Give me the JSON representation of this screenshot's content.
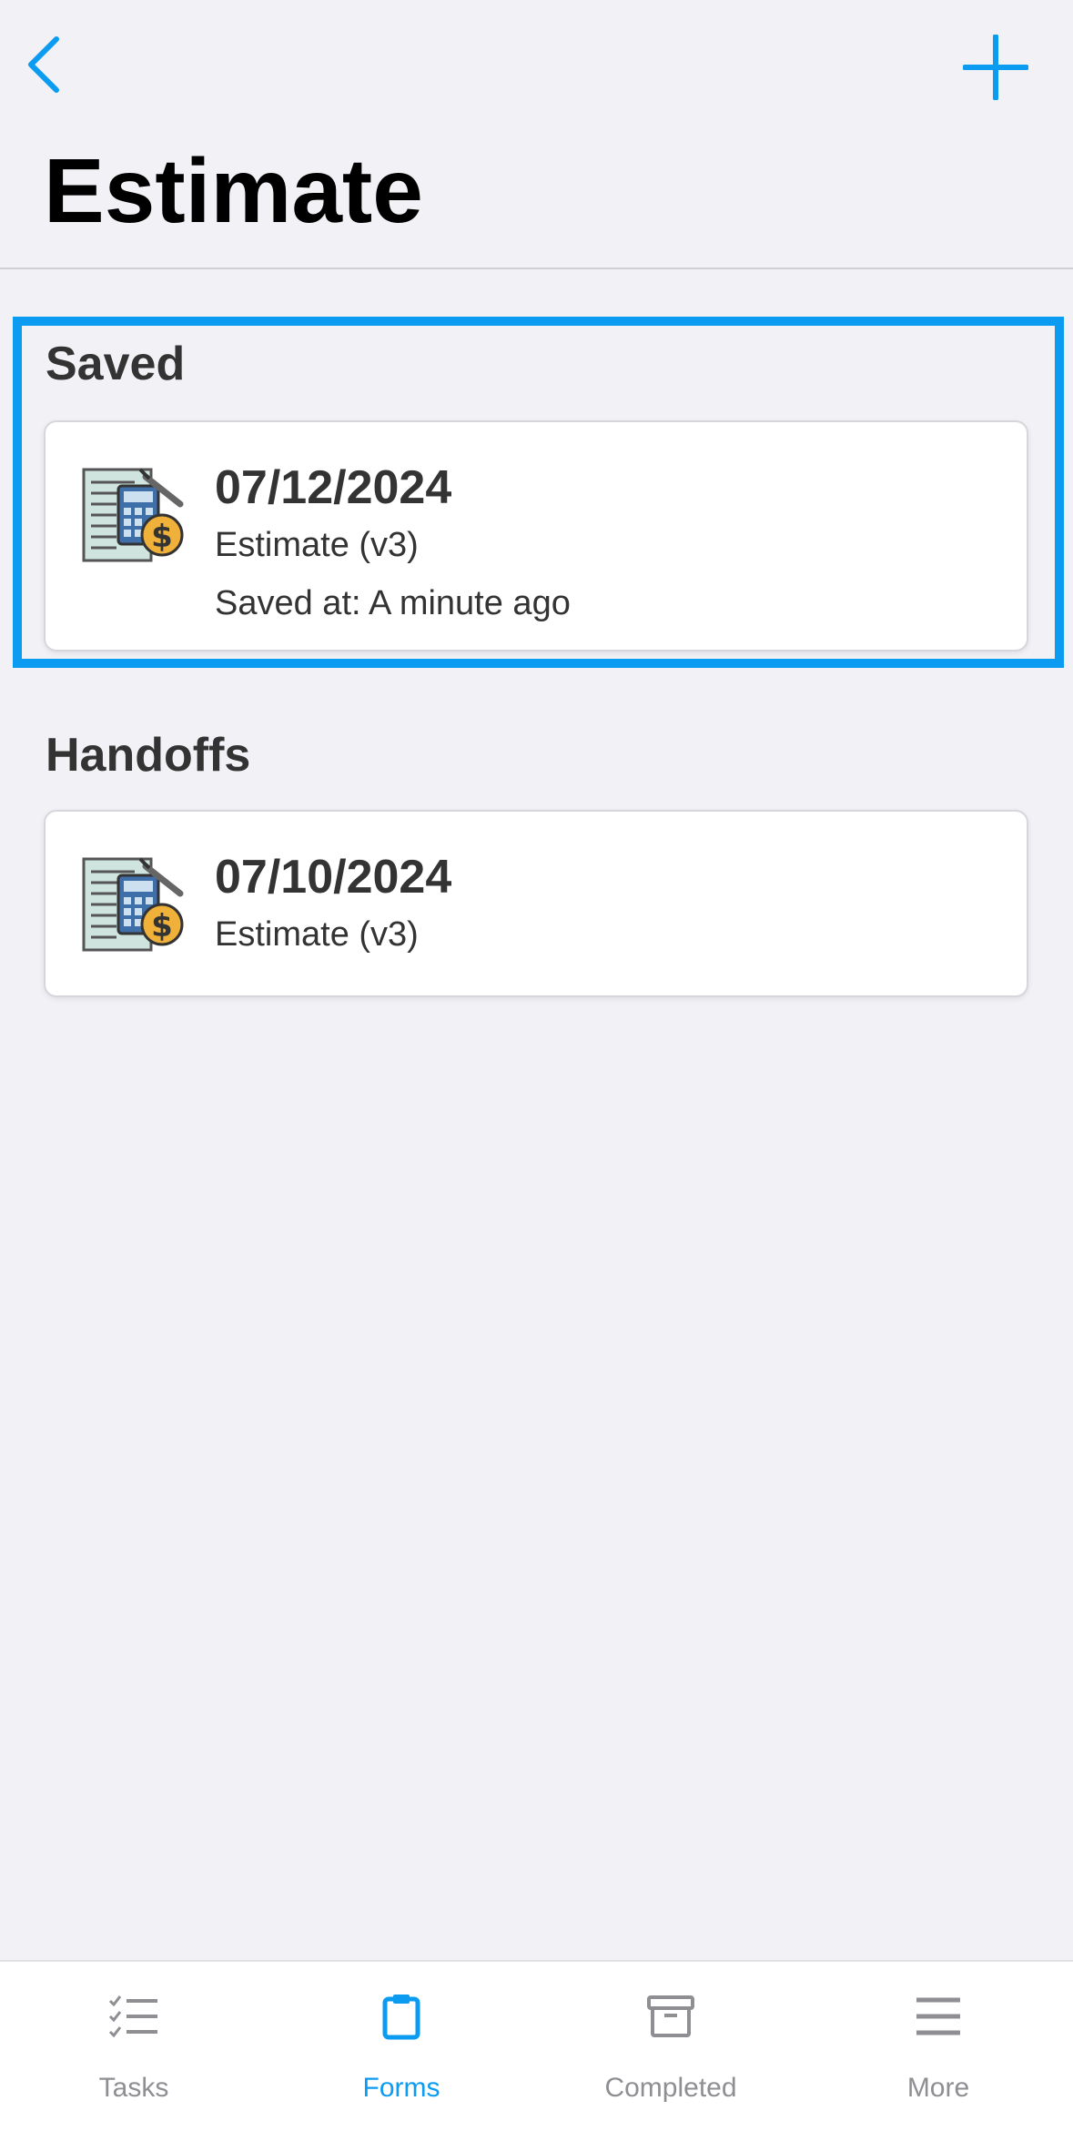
{
  "header": {
    "title": "Estimate",
    "back_icon": "chevron-left-icon",
    "add_icon": "plus-icon"
  },
  "sections": {
    "saved": {
      "title": "Saved",
      "card": {
        "date": "07/12/2024",
        "form_name": "Estimate (v3)",
        "saved_at": "Saved at: A minute ago",
        "icon": "estimate-form-icon"
      }
    },
    "handoffs": {
      "title": "Handoffs",
      "card": {
        "date": "07/10/2024",
        "form_name": "Estimate (v3)",
        "icon": "estimate-form-icon"
      }
    }
  },
  "tabbar": {
    "tabs": [
      {
        "label": "Tasks",
        "icon": "tasks-checklist-icon",
        "active": false
      },
      {
        "label": "Forms",
        "icon": "clipboard-icon",
        "active": true
      },
      {
        "label": "Completed",
        "icon": "archive-box-icon",
        "active": false
      },
      {
        "label": "More",
        "icon": "menu-icon",
        "active": false
      }
    ]
  },
  "colors": {
    "accent": "#0b9bf0",
    "background": "#f1f1f6",
    "text": "#333333",
    "inactive_tab": "#8e8e93"
  }
}
